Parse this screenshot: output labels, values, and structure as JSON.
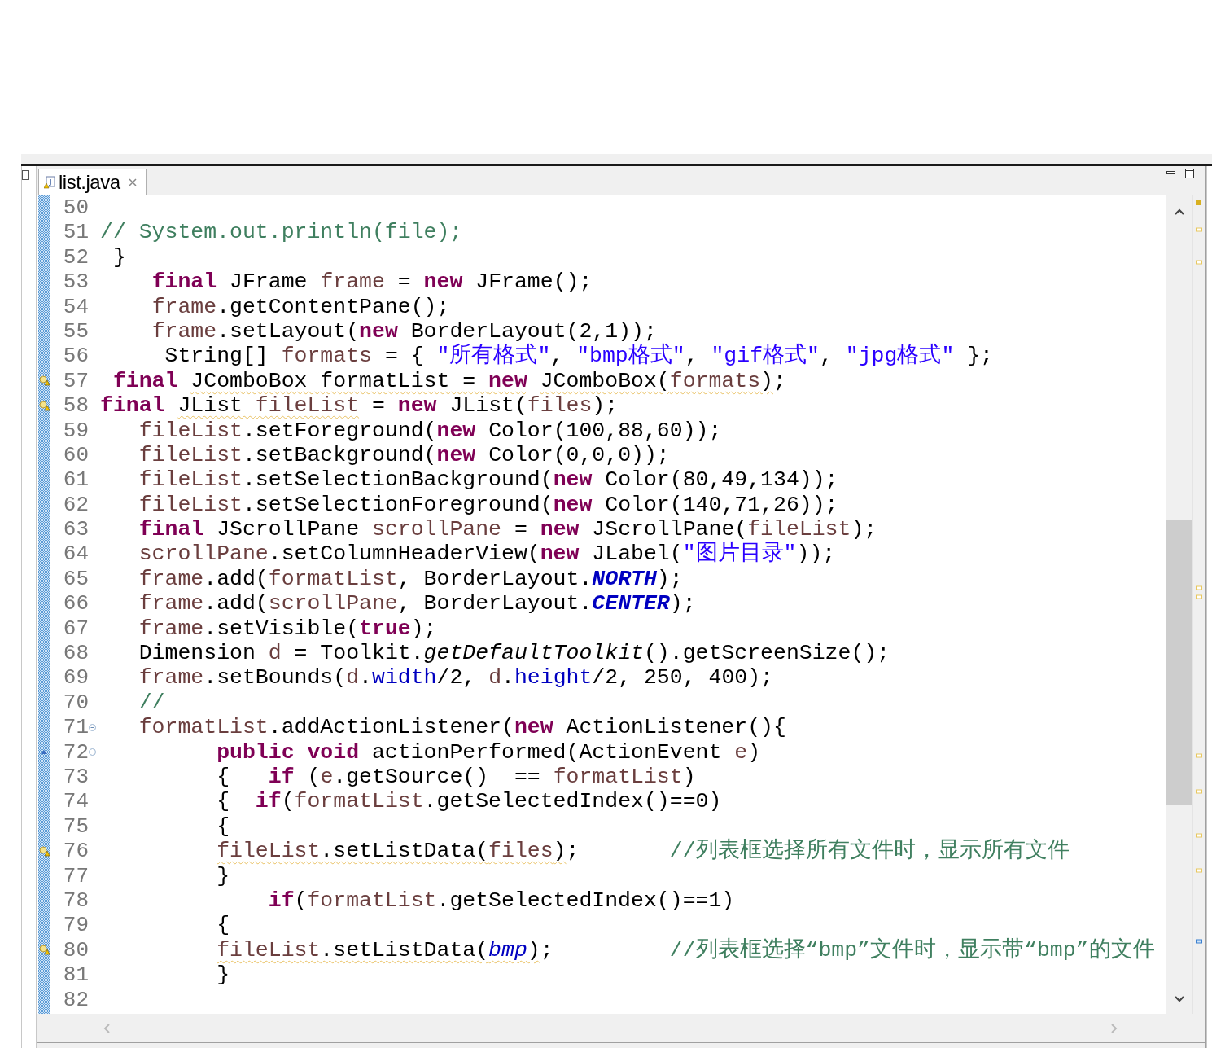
{
  "editor": {
    "tab": {
      "title": "list.java",
      "selected": true
    },
    "lines": [
      {
        "n": "50",
        "fold": false
      },
      {
        "n": "51",
        "fold": false,
        "tokens": [
          {
            "t": "// System.out.println(file);",
            "kind": "comment"
          }
        ]
      },
      {
        "n": "52",
        "fold": false,
        "tokens": [
          {
            "t": " }",
            "kind": "plain"
          }
        ]
      },
      {
        "n": "53",
        "fold": false,
        "tokens": [
          {
            "t": "    final",
            "kind": "keyword"
          },
          {
            "t": " JFrame ",
            "kind": "plain"
          },
          {
            "t": "frame",
            "kind": "var"
          },
          {
            "t": " = ",
            "kind": "plain"
          },
          {
            "t": "new",
            "kind": "keyword"
          },
          {
            "t": " JFrame();",
            "kind": "plain"
          }
        ]
      },
      {
        "n": "54",
        "fold": false,
        "tokens": [
          {
            "t": "    frame",
            "kind": "var"
          },
          {
            "t": ".getContentPane();",
            "kind": "plain"
          }
        ]
      },
      {
        "n": "55",
        "fold": false,
        "tokens": [
          {
            "t": "    frame",
            "kind": "var"
          },
          {
            "t": ".setLayout(",
            "kind": "plain"
          },
          {
            "t": "new",
            "kind": "keyword"
          },
          {
            "t": " BorderLayout(2,1));",
            "kind": "plain"
          }
        ]
      },
      {
        "n": "56",
        "fold": false,
        "tokens": [
          {
            "t": "     String[] ",
            "kind": "plain"
          },
          {
            "t": "formats",
            "kind": "var"
          },
          {
            "t": " = { ",
            "kind": "plain"
          },
          {
            "t": "\"所有格式\"",
            "kind": "string"
          },
          {
            "t": ", ",
            "kind": "plain"
          },
          {
            "t": "\"bmp格式\"",
            "kind": "string"
          },
          {
            "t": ", ",
            "kind": "plain"
          },
          {
            "t": "\"gif格式\"",
            "kind": "string"
          },
          {
            "t": ", ",
            "kind": "plain"
          },
          {
            "t": "\"jpg格式\"",
            "kind": "string"
          },
          {
            "t": " };",
            "kind": "plain"
          }
        ]
      },
      {
        "n": "57",
        "fold": false,
        "marker": {
          "kind": "warning"
        },
        "tokens": [
          {
            "t": " final ",
            "kind": "keyword"
          },
          {
            "t": "JComboBox formatList = ",
            "kind": "plain",
            "w": true
          },
          {
            "t": "new",
            "kind": "keyword",
            "w": true
          },
          {
            "t": " JComboBox(",
            "kind": "plain",
            "w": true
          },
          {
            "t": "formats",
            "kind": "var",
            "w": true
          },
          {
            "t": ")",
            "kind": "plain",
            "w": true
          },
          {
            "t": ";",
            "kind": "plain"
          }
        ]
      },
      {
        "n": "58",
        "fold": false,
        "marker": {
          "kind": "warning"
        },
        "tokens": [
          {
            "t": "final ",
            "kind": "keyword"
          },
          {
            "t": "JList ",
            "kind": "plain",
            "w": true
          },
          {
            "t": "fileList",
            "kind": "var",
            "w": true
          },
          {
            "t": " = ",
            "kind": "plain"
          },
          {
            "t": "new",
            "kind": "keyword"
          },
          {
            "t": " JList(",
            "kind": "plain"
          },
          {
            "t": "files",
            "kind": "var"
          },
          {
            "t": ");",
            "kind": "plain"
          }
        ]
      },
      {
        "n": "59",
        "fold": false,
        "tokens": [
          {
            "t": "   fileList",
            "kind": "var"
          },
          {
            "t": ".setForeground(",
            "kind": "plain"
          },
          {
            "t": "new",
            "kind": "keyword"
          },
          {
            "t": " Color(100,88,60));",
            "kind": "plain"
          }
        ]
      },
      {
        "n": "60",
        "fold": false,
        "tokens": [
          {
            "t": "   fileList",
            "kind": "var"
          },
          {
            "t": ".setBackground(",
            "kind": "plain"
          },
          {
            "t": "new",
            "kind": "keyword"
          },
          {
            "t": " Color(0,0,0));",
            "kind": "plain"
          }
        ]
      },
      {
        "n": "61",
        "fold": false,
        "tokens": [
          {
            "t": "   fileList",
            "kind": "var"
          },
          {
            "t": ".setSelectionBackground(",
            "kind": "plain"
          },
          {
            "t": "new",
            "kind": "keyword"
          },
          {
            "t": " Color(80,49,134));",
            "kind": "plain"
          }
        ]
      },
      {
        "n": "62",
        "fold": false,
        "tokens": [
          {
            "t": "   fileList",
            "kind": "var"
          },
          {
            "t": ".setSelectionForeground(",
            "kind": "plain"
          },
          {
            "t": "new",
            "kind": "keyword"
          },
          {
            "t": " Color(140,71,26));",
            "kind": "plain"
          }
        ]
      },
      {
        "n": "63",
        "fold": false,
        "tokens": [
          {
            "t": "   final",
            "kind": "keyword"
          },
          {
            "t": " JScrollPane ",
            "kind": "plain"
          },
          {
            "t": "scrollPane",
            "kind": "var"
          },
          {
            "t": " = ",
            "kind": "plain"
          },
          {
            "t": "new",
            "kind": "keyword"
          },
          {
            "t": " JScrollPane(",
            "kind": "plain"
          },
          {
            "t": "fileList",
            "kind": "var"
          },
          {
            "t": ");",
            "kind": "plain"
          }
        ]
      },
      {
        "n": "64",
        "fold": false,
        "tokens": [
          {
            "t": "   scrollPane",
            "kind": "var"
          },
          {
            "t": ".setColumnHeaderView(",
            "kind": "plain"
          },
          {
            "t": "new",
            "kind": "keyword"
          },
          {
            "t": " JLabel(",
            "kind": "plain"
          },
          {
            "t": "\"图片目录\"",
            "kind": "string"
          },
          {
            "t": "));",
            "kind": "plain"
          }
        ]
      },
      {
        "n": "65",
        "fold": false,
        "tokens": [
          {
            "t": "   frame",
            "kind": "var"
          },
          {
            "t": ".add(",
            "kind": "plain"
          },
          {
            "t": "formatList",
            "kind": "var"
          },
          {
            "t": ", BorderLayout.",
            "kind": "plain"
          },
          {
            "t": "NORTH",
            "kind": "constant"
          },
          {
            "t": ");",
            "kind": "plain"
          }
        ]
      },
      {
        "n": "66",
        "fold": false,
        "tokens": [
          {
            "t": "   frame",
            "kind": "var"
          },
          {
            "t": ".add(",
            "kind": "plain"
          },
          {
            "t": "scrollPane",
            "kind": "var"
          },
          {
            "t": ", BorderLayout.",
            "kind": "plain"
          },
          {
            "t": "CENTER",
            "kind": "constant"
          },
          {
            "t": ");",
            "kind": "plain"
          }
        ]
      },
      {
        "n": "67",
        "fold": false,
        "tokens": [
          {
            "t": "   frame",
            "kind": "var"
          },
          {
            "t": ".setVisible(",
            "kind": "plain"
          },
          {
            "t": "true",
            "kind": "keyword"
          },
          {
            "t": ");",
            "kind": "plain"
          }
        ]
      },
      {
        "n": "68",
        "fold": false,
        "tokens": [
          {
            "t": "   Dimension ",
            "kind": "plain"
          },
          {
            "t": "d",
            "kind": "var"
          },
          {
            "t": " = Toolkit.",
            "kind": "plain"
          },
          {
            "t": "getDefaultToolkit",
            "kind": "static"
          },
          {
            "t": "().getScreenSize();",
            "kind": "plain"
          }
        ]
      },
      {
        "n": "69",
        "fold": false,
        "tokens": [
          {
            "t": "   frame",
            "kind": "var"
          },
          {
            "t": ".setBounds(",
            "kind": "plain"
          },
          {
            "t": "d",
            "kind": "var"
          },
          {
            "t": ".",
            "kind": "plain"
          },
          {
            "t": "width",
            "kind": "field"
          },
          {
            "t": "/2, ",
            "kind": "plain"
          },
          {
            "t": "d",
            "kind": "var"
          },
          {
            "t": ".",
            "kind": "plain"
          },
          {
            "t": "height",
            "kind": "field"
          },
          {
            "t": "/2, 250, 400);",
            "kind": "plain"
          }
        ]
      },
      {
        "n": "70",
        "fold": false,
        "tokens": [
          {
            "t": "   //",
            "kind": "comment"
          }
        ]
      },
      {
        "n": "71",
        "fold": true,
        "tokens": [
          {
            "t": "   formatList",
            "kind": "var"
          },
          {
            "t": ".addActionListener(",
            "kind": "plain"
          },
          {
            "t": "new",
            "kind": "keyword"
          },
          {
            "t": " ActionListener(){",
            "kind": "plain"
          }
        ]
      },
      {
        "n": "72",
        "fold": true,
        "marker": {
          "kind": "override"
        },
        "tokens": [
          {
            "t": "         public void",
            "kind": "keyword"
          },
          {
            "t": " actionPerformed(ActionEvent ",
            "kind": "plain"
          },
          {
            "t": "e",
            "kind": "var"
          },
          {
            "t": ")",
            "kind": "plain"
          }
        ]
      },
      {
        "n": "73",
        "fold": false,
        "tokens": [
          {
            "t": "         {   ",
            "kind": "plain"
          },
          {
            "t": "if",
            "kind": "keyword"
          },
          {
            "t": " (",
            "kind": "plain"
          },
          {
            "t": "e",
            "kind": "var"
          },
          {
            "t": ".getSource()  == ",
            "kind": "plain"
          },
          {
            "t": "formatList",
            "kind": "var"
          },
          {
            "t": ")",
            "kind": "plain"
          }
        ]
      },
      {
        "n": "74",
        "fold": false,
        "tokens": [
          {
            "t": "         {  ",
            "kind": "plain"
          },
          {
            "t": "if",
            "kind": "keyword"
          },
          {
            "t": "(",
            "kind": "plain"
          },
          {
            "t": "formatList",
            "kind": "var"
          },
          {
            "t": ".getSelectedIndex()==0)",
            "kind": "plain"
          }
        ]
      },
      {
        "n": "75",
        "fold": false,
        "tokens": [
          {
            "t": "         {",
            "kind": "plain"
          }
        ]
      },
      {
        "n": "76",
        "fold": false,
        "marker": {
          "kind": "warning"
        },
        "tokens": [
          {
            "t": "         fileList",
            "kind": "var",
            "w": true
          },
          {
            "t": ".setListData(",
            "kind": "plain",
            "w": true
          },
          {
            "t": "files",
            "kind": "var",
            "w": true
          },
          {
            "t": ")",
            "kind": "plain",
            "w": true
          },
          {
            "t": ";       ",
            "kind": "plain"
          },
          {
            "t": "//列表框选择所有文件时，显示所有文件",
            "kind": "comment"
          }
        ]
      },
      {
        "n": "77",
        "fold": false,
        "tokens": [
          {
            "t": "         }",
            "kind": "plain"
          }
        ]
      },
      {
        "n": "78",
        "fold": false,
        "tokens": [
          {
            "t": "             if",
            "kind": "keyword"
          },
          {
            "t": "(",
            "kind": "plain"
          },
          {
            "t": "formatList",
            "kind": "var"
          },
          {
            "t": ".getSelectedIndex()==1)",
            "kind": "plain"
          }
        ]
      },
      {
        "n": "79",
        "fold": false,
        "tokens": [
          {
            "t": "         {",
            "kind": "plain"
          }
        ]
      },
      {
        "n": "80",
        "fold": false,
        "marker": {
          "kind": "warning"
        },
        "tokens": [
          {
            "t": "         fileList",
            "kind": "var",
            "w": true
          },
          {
            "t": ".setListData(",
            "kind": "plain",
            "w": true
          },
          {
            "t": "bmp",
            "kind": "static-field",
            "w": true
          },
          {
            "t": ")",
            "kind": "plain",
            "w": true
          },
          {
            "t": ";         ",
            "kind": "plain"
          },
          {
            "t": "//列表框选择“bmp”文件时，显示带“bmp”的文件",
            "kind": "comment"
          }
        ]
      },
      {
        "n": "81",
        "fold": false,
        "tokens": [
          {
            "t": "         }",
            "kind": "plain"
          }
        ]
      },
      {
        "n": "82",
        "fold": false
      }
    ]
  }
}
